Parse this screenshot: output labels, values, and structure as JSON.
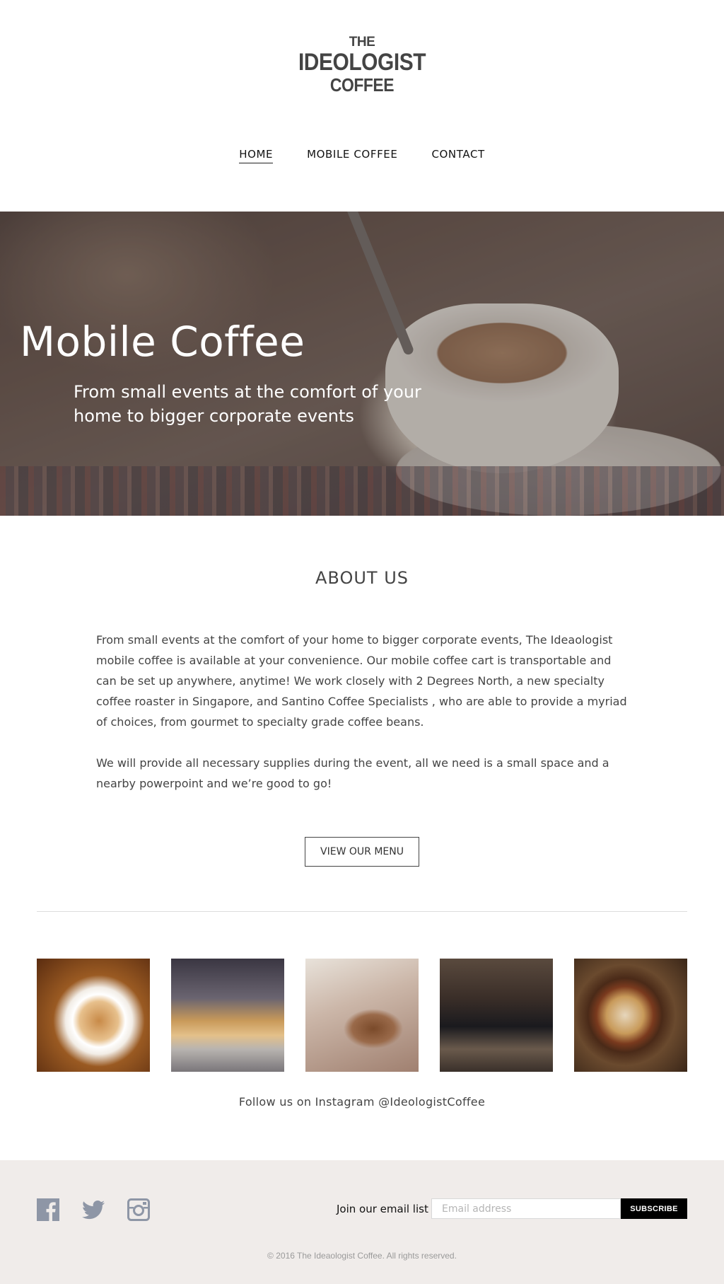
{
  "logo": {
    "line1": "THE",
    "line2": "IDEOLOGIST",
    "line3": "COFFEE"
  },
  "nav": {
    "items": [
      {
        "label": "HOME",
        "active": true
      },
      {
        "label": "MOBILE COFFEE",
        "active": false
      },
      {
        "label": "CONTACT",
        "active": false
      }
    ]
  },
  "hero": {
    "title": "Mobile Coffee",
    "subtitle": "From small events at the comfort of your home to bigger corporate events"
  },
  "about": {
    "title": "ABOUT US",
    "paragraphs": [
      "From small events at the comfort of your home to bigger corporate events, The Ideaologist mobile coffee is available at your convenience. Our mobile coffee cart is transportable and can be set up anywhere, anytime! We work closely with 2 Degrees North, a new specialty coffee roaster in Singapore, and Santino Coffee Specialists , who are able to provide a myriad of choices, from gourmet to specialty grade coffee beans.",
      "We will provide all necessary supplies during the event, all we need is a small space and a nearby powerpoint and we’re good to go!"
    ],
    "button_label": "VIEW OUR MENU"
  },
  "instagram": {
    "caption": "Follow us on Instagram @IdeologistCoffee"
  },
  "footer": {
    "social_icons": [
      "facebook-icon",
      "twitter-icon",
      "instagram-icon"
    ],
    "icon_color": "#8e96a6",
    "email_label": "Join our email list",
    "email_placeholder": "Email address",
    "subscribe_label": "SUBSCRIBE",
    "copyright": "© 2016 The Ideaologist Coffee. All rights reserved."
  }
}
